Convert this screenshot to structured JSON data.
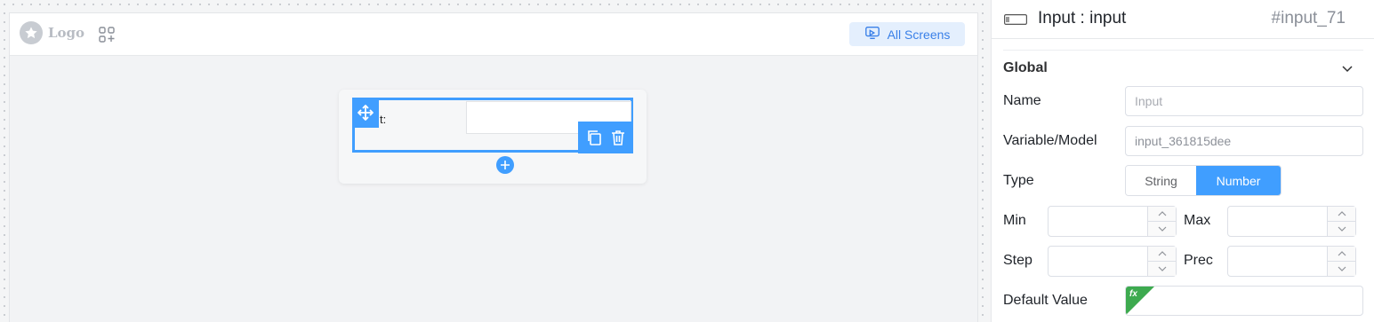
{
  "canvas": {
    "logo_text": "Logo",
    "all_screens_label": "All Screens",
    "form": {
      "field_label": "t:"
    }
  },
  "panel": {
    "component_title": "Input : input",
    "component_id": "#input_71",
    "section_title": "Global",
    "name_label": "Name",
    "name_placeholder": "Input",
    "variable_label": "Variable/Model",
    "variable_value": "input_361815dee",
    "type_label": "Type",
    "type_options": [
      "String",
      "Number"
    ],
    "type_selected": "Number",
    "min_label": "Min",
    "max_label": "Max",
    "step_label": "Step",
    "prec_label": "Prec",
    "default_label": "Default Value",
    "fx_badge": "fx"
  },
  "colors": {
    "accent": "#409eff",
    "fx_green": "#3daa4f",
    "all_screens_bg": "#e4effd"
  },
  "icons": [
    "star-icon",
    "apps-icon",
    "monitor-icon",
    "move-icon",
    "copy-icon",
    "delete-icon",
    "plus-icon",
    "chevron-down-icon",
    "input-component-icon",
    "caret-up-icon",
    "caret-down-icon"
  ]
}
